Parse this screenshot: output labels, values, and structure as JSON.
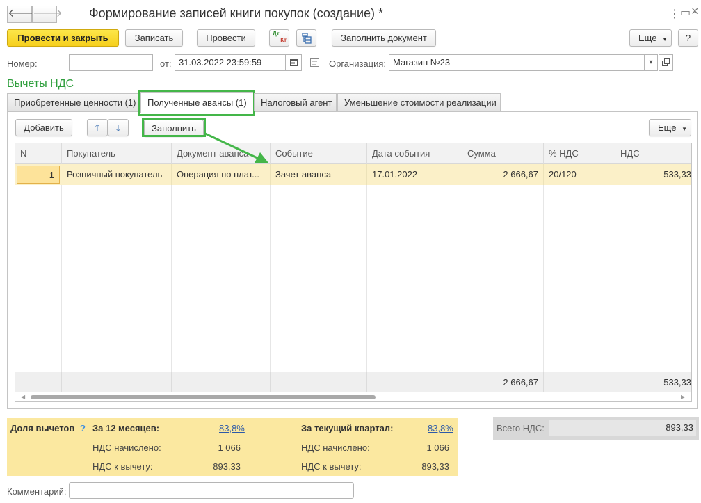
{
  "window": {
    "title": "Формирование записей книги покупок (создание) *"
  },
  "nav": {
    "back_icon": "arrow-left-icon",
    "forward_icon": "arrow-right-icon",
    "back_glyph": "🡐",
    "forward_glyph": "🡒"
  },
  "window_controls": {
    "more_glyph": "⋮",
    "maximize_glyph": "▭",
    "close_glyph": "×"
  },
  "toolbar": {
    "post_close_label": "Провести и закрыть",
    "save_label": "Записать",
    "post_label": "Провести",
    "dt_label": "Дт",
    "kt_label": "Кт",
    "fill_doc_label": "Заполнить документ",
    "more_label": "Еще",
    "help_label": "?"
  },
  "header": {
    "number_label": "Номер:",
    "number_value": "",
    "date_label": "от:",
    "date_value": "31.03.2022 23:59:59",
    "org_label": "Организация:",
    "org_value": "Магазин №23"
  },
  "section": {
    "title": "Вычеты НДС"
  },
  "tabs": [
    {
      "label": "Приобретенные ценности (1)",
      "active": false
    },
    {
      "label": "Полученные авансы (1)",
      "active": true
    },
    {
      "label": "Налоговый агент",
      "active": false
    },
    {
      "label": "Уменьшение стоимости реализации",
      "active": false
    }
  ],
  "table_toolbar": {
    "add_label": "Добавить",
    "up_icon": "arrow-up-icon",
    "down_icon": "arrow-down-icon",
    "up_glyph": "🡑",
    "down_glyph": "🡓",
    "fill_label": "Заполнить",
    "more_label": "Еще"
  },
  "table": {
    "columns": [
      "N",
      "Покупатель",
      "Документ аванса",
      "Событие",
      "Дата события",
      "Сумма",
      "% НДС",
      "НДС"
    ],
    "rows": [
      {
        "n": "1",
        "buyer": "Розничный покупатель",
        "doc": "Операция по плат...",
        "event": "Зачет аванса",
        "date": "17.01.2022",
        "sum": "2 666,67",
        "vat_rate": "20/120",
        "vat": "533,33"
      }
    ],
    "totals": {
      "sum": "2 666,67",
      "vat": "533,33"
    }
  },
  "deduction": {
    "share_label": "Доля вычетов",
    "help_glyph": "?",
    "year": {
      "title": "За 12 месяцев:",
      "percent": "83,8%",
      "accrued_label": "НДС начислено:",
      "accrued_value": "1 066",
      "deductible_label": "НДС к вычету:",
      "deductible_value": "893,33"
    },
    "quarter": {
      "title": "За текущий квартал:",
      "percent": "83,8%",
      "accrued_label": "НДС начислено:",
      "accrued_value": "1 066",
      "deductible_label": "НДС к вычету:",
      "deductible_value": "893,33"
    }
  },
  "total_vat": {
    "label": "Всего НДС:",
    "value": "893,33"
  },
  "comment": {
    "label": "Комментарий:",
    "value": ""
  },
  "colors": {
    "accent_green": "#44b649",
    "primary_yellow": "#f6cf1d",
    "row_highlight": "#fbf0c8",
    "panel_yellow": "#fbe8a0"
  }
}
